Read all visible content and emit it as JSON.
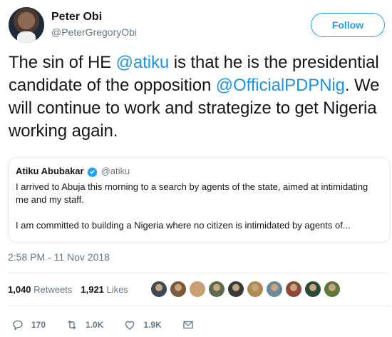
{
  "header": {
    "display_name": "Peter Obi",
    "handle": "@PeterGregoryObi",
    "follow_label": "Follow"
  },
  "tweet": {
    "text_parts": [
      "The sin of HE ",
      "@atiku",
      " is that he is the presidential candidate of the opposition ",
      "@OfficialPDPNig",
      ". We will continue to work and strategize to get Nigeria working again."
    ]
  },
  "quote": {
    "name": "Atiku Abubakar",
    "handle": "@atiku",
    "para1": "I arrived to Abuja this morning to a search by agents of the state, aimed at intimidating me and my staff.",
    "para2": "I am committed to building a Nigeria where no citizen is intimidated by agents of..."
  },
  "timestamp": "2:58 PM - 11 Nov 2018",
  "stats": {
    "retweets_count": "1,040",
    "retweets_label": "Retweets",
    "likes_count": "1,921",
    "likes_label": "Likes"
  },
  "liker_avatar_colors": [
    "#3a4a5a",
    "#7a5a3a",
    "#c8a070",
    "#5a6a4a",
    "#3a3a3a",
    "#b08a50",
    "#6a8a9a",
    "#8a4a3a",
    "#2a4a3a",
    "#5a7a3a"
  ],
  "actions": {
    "reply_count": "170",
    "retweet_count": "1.0K",
    "like_count": "1.9K"
  },
  "colors": {
    "accent": "#1da1f2",
    "mention": "#1b95e0",
    "muted": "#657786",
    "verified": "#1da1f2"
  }
}
